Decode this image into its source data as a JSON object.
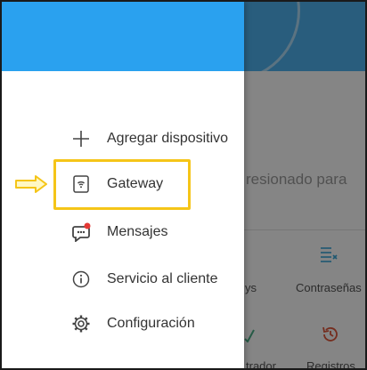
{
  "drawer": {
    "items": [
      {
        "label": "Agregar dispositivo",
        "icon": "plus-icon"
      },
      {
        "label": "Gateway",
        "icon": "gateway-icon"
      },
      {
        "label": "Mensajes",
        "icon": "messages-icon"
      },
      {
        "label": "Servicio al cliente",
        "icon": "info-icon"
      },
      {
        "label": "Configuración",
        "icon": "gear-icon"
      }
    ],
    "header_color": "#2aa1ef"
  },
  "background": {
    "partial_text": "resionado para",
    "labels": [
      "ys",
      "Contraseñas",
      "trador",
      "Registros"
    ]
  },
  "annotation": {
    "highlight_color": "#f5c518"
  }
}
